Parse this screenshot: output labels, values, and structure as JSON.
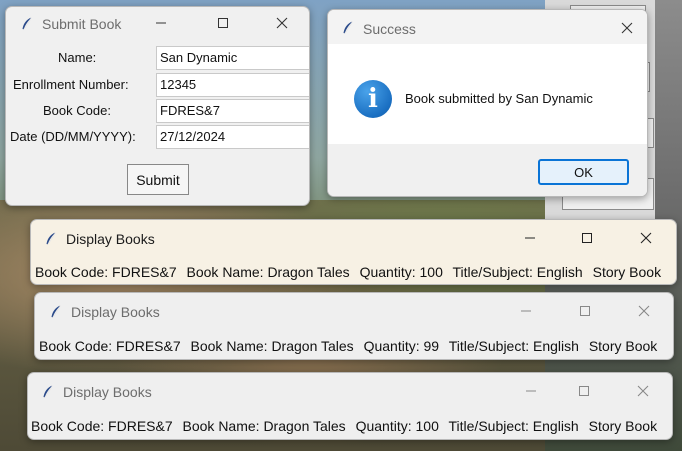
{
  "submit_window": {
    "title": "Submit Book",
    "fields": [
      {
        "label": "Name:",
        "value": "San Dynamic"
      },
      {
        "label": "Enrollment Number:",
        "value": "12345"
      },
      {
        "label": "Book Code:",
        "value": "FDRES&7"
      },
      {
        "label": "Date (DD/MM/YYYY):",
        "value": "27/12/2024"
      }
    ],
    "submit_label": "Submit"
  },
  "success_dialog": {
    "title": "Success",
    "icon": "info-icon",
    "icon_glyph": "i",
    "message": "Book submitted by San Dynamic",
    "ok_label": "OK"
  },
  "display_windows": [
    {
      "title": "Display Books",
      "book_code": "Book Code: FDRES&7",
      "book_name": "Book Name: Dragon Tales",
      "quantity": "Quantity: 100",
      "subject": "Title/Subject: English",
      "type": "Story Book"
    },
    {
      "title": "Display Books",
      "book_code": "Book Code: FDRES&7",
      "book_name": "Book Name: Dragon Tales",
      "quantity": "Quantity: 99",
      "subject": "Title/Subject: English",
      "type": "Story Book"
    },
    {
      "title": "Display Books",
      "book_code": "Book Code: FDRES&7",
      "book_name": "Book Name: Dragon Tales",
      "quantity": "Quantity: 100",
      "subject": "Title/Subject: English",
      "type": "Story Book"
    }
  ],
  "colors": {
    "accent": "#0a74d6",
    "info_icon": "#1a6fc2"
  }
}
